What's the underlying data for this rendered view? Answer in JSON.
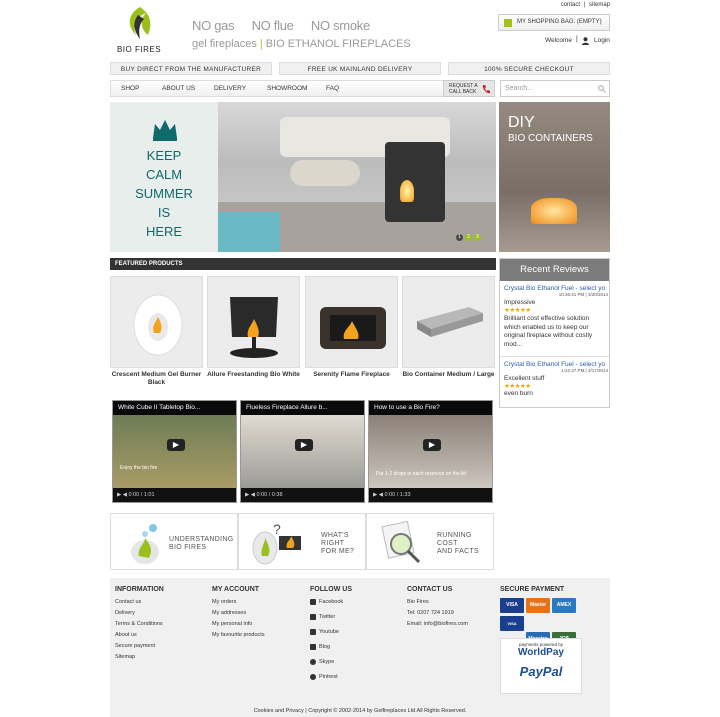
{
  "header": {
    "top_links": [
      "contact",
      "|",
      "sitemap"
    ],
    "logo_text": "BIO FIRES",
    "tagline": [
      "NO gas",
      "NO flue",
      "NO smoke"
    ],
    "subtag_left": "gel fireplaces",
    "subtag_right": "BIO ETHANOL FIREPLACES",
    "bag_label": "MY SHOPPING BAG: (EMPTY)",
    "welcome": "Welcome",
    "divider": "|",
    "login": "Login"
  },
  "strip": [
    "BUY DIRECT FROM THE MANUFACTURER",
    "FREE UK MAINLAND DELIVERY",
    "100% SECURE CHECKOUT"
  ],
  "nav": {
    "items": [
      "SHOP",
      "ABOUT US",
      "DELIVERY",
      "SHOWROOM",
      "FAQ"
    ],
    "callback_line1": "REQUEST A",
    "callback_line2": "CALL BACK",
    "search_placeholder": "Search..."
  },
  "hero": {
    "lines": [
      "KEEP",
      "CALM",
      "SUMMER",
      "IS",
      "HERE"
    ],
    "slides": [
      "1",
      "2",
      "3"
    ],
    "active_slide": 2
  },
  "diy": {
    "title": "DIY",
    "subtitle": "BIO CONTAINERS"
  },
  "featured": {
    "heading": "FEATURED PRODUCTS",
    "products": [
      "Crescent Medium Gel Burner Black",
      "Allure Freestanding Bio White",
      "Serenity Flame Fireplace",
      "Bio Container Medium / Large"
    ],
    "videos": [
      {
        "title": "White Cube II Tabletop Bio...",
        "time": "0:00 / 1:01",
        "caption": "Enjoy the bio fire"
      },
      {
        "title": "Flueless Fireplace Allure b...",
        "time": "0:00 / 0:38",
        "caption": ""
      },
      {
        "title": "How to use a Bio Fire?",
        "time": "0:00 / 1:33",
        "caption": "Put 1-2 drops in each reservoir on the lid"
      }
    ]
  },
  "reviews": {
    "heading": "Recent Reviews",
    "items": [
      {
        "product": "Crystal Bio Ethanol Fuel - select yo",
        "date": "10:36:41 PM | 3/30/2014",
        "title": "Impressive",
        "stars": "★★★★★",
        "text": [
          "Brilliant cost effective solution",
          "which enabled us to keep our",
          "original fireplace without costly",
          "mod..."
        ]
      },
      {
        "product": "Crystal Bio Ethanol Fuel - select yo",
        "date": "1:22:47 PM | 3/17/2014",
        "title": "Excellent stuff",
        "stars": "★★★★★",
        "text": [
          "even burn"
        ]
      }
    ]
  },
  "info_boxes": [
    {
      "line1": "UNDERSTANDING",
      "line2": "BIO FIRES"
    },
    {
      "line1": "WHAT'S",
      "line2": "RIGHT",
      "line3": "FOR ME?"
    },
    {
      "line1": "RUNNING",
      "line2": "COST",
      "line3": "AND FACTS"
    }
  ],
  "footer": {
    "information": {
      "heading": "INFORMATION",
      "links": [
        "Contact us",
        "Delivery",
        "Terms & Conditions",
        "About us",
        "Secure payment",
        "Sitemap"
      ]
    },
    "account": {
      "heading": "MY ACCOUNT",
      "links": [
        "My orders",
        "My addresses",
        "My personal info",
        "My favourite products"
      ]
    },
    "follow": {
      "heading": "FOLLOW US",
      "links": [
        "Facebook",
        "Twitter",
        "Youtube",
        "Blog",
        "Skype",
        "Pintrest"
      ]
    },
    "contact": {
      "heading": "CONTACT US",
      "name": "Bio Fires",
      "tel": "Tel: 0207 724 1919",
      "email": "Email: info@biofires.com"
    },
    "payment": {
      "heading": "SECURE PAYMENT",
      "cards": [
        "VISA",
        "Master",
        "AMEX",
        "VISA Electron",
        "Maestro",
        "JCB"
      ],
      "powered_by": "payments powered by",
      "worldpay": "WorldPay",
      "paypal": "PayPal"
    },
    "copyright": "Cookies and Privacy | Copyright © 2002-2014 by Gelfireplaces Ltd All Rights Reserved."
  },
  "colors": {
    "accent_green": "#97c11f",
    "teal": "#0f6a69",
    "link_blue": "#2a5da8",
    "dark_bar": "#333333",
    "review_header": "#7b7b7b"
  }
}
